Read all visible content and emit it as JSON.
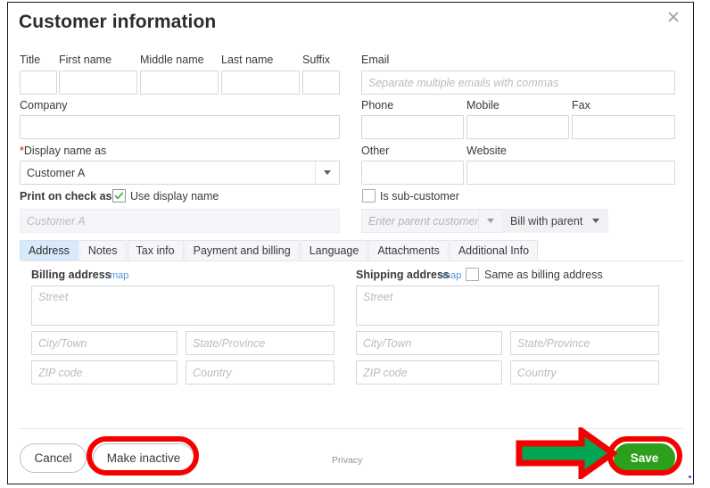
{
  "dialog": {
    "title": "Customer information",
    "close_icon": "close-x-icon"
  },
  "name_row": {
    "fields": [
      {
        "label": "Title",
        "value": "",
        "placeholder": ""
      },
      {
        "label": "First name",
        "value": "",
        "placeholder": ""
      },
      {
        "label": "Middle name",
        "value": "",
        "placeholder": ""
      },
      {
        "label": "Last name",
        "value": "",
        "placeholder": ""
      },
      {
        "label": "Suffix",
        "value": "",
        "placeholder": ""
      }
    ]
  },
  "company": {
    "label": "Company",
    "value": "",
    "placeholder": ""
  },
  "display_name": {
    "required_marker": "*",
    "label": "Display name as",
    "value": "Customer A",
    "dropdown_icon": "chevron-down-icon"
  },
  "print_on_check": {
    "label": "Print on check as",
    "checkbox_label": "Use display name",
    "checked": true,
    "check_icon": "checkmark-icon",
    "value": "",
    "placeholder": "Customer A",
    "disabled": true
  },
  "contact": {
    "email": {
      "label": "Email",
      "value": "",
      "placeholder": "Separate multiple emails with commas"
    },
    "phone": {
      "label": "Phone",
      "value": "",
      "placeholder": ""
    },
    "mobile": {
      "label": "Mobile",
      "value": "",
      "placeholder": ""
    },
    "fax": {
      "label": "Fax",
      "value": "",
      "placeholder": ""
    },
    "other": {
      "label": "Other",
      "value": "",
      "placeholder": ""
    },
    "website": {
      "label": "Website",
      "value": "",
      "placeholder": ""
    }
  },
  "sub_customer": {
    "checkbox_label": "Is sub-customer",
    "checked": false,
    "parent_value": "Enter parent customer",
    "parent_dropdown_icon": "chevron-down-icon",
    "billing_option": "Bill with parent",
    "billing_dropdown_icon": "chevron-down-icon"
  },
  "tabs": {
    "items": [
      {
        "label": "Address",
        "active": true
      },
      {
        "label": "Notes",
        "active": false
      },
      {
        "label": "Tax info",
        "active": false
      },
      {
        "label": "Payment and billing",
        "active": false
      },
      {
        "label": "Language",
        "active": false
      },
      {
        "label": "Attachments",
        "active": false
      },
      {
        "label": "Additional Info",
        "active": false
      }
    ]
  },
  "billing_address": {
    "heading": "Billing address",
    "map_link": "map",
    "street": {
      "value": "",
      "placeholder": "Street"
    },
    "city": {
      "value": "",
      "placeholder": "City/Town"
    },
    "state": {
      "value": "",
      "placeholder": "State/Province"
    },
    "zip": {
      "value": "",
      "placeholder": "ZIP code"
    },
    "country": {
      "value": "",
      "placeholder": "Country"
    }
  },
  "shipping_address": {
    "heading": "Shipping address",
    "map_link": "map",
    "same_as_billing_label": "Same as billing address",
    "same_as_billing_checked": false,
    "street": {
      "value": "",
      "placeholder": "Street"
    },
    "city": {
      "value": "",
      "placeholder": "City/Town"
    },
    "state": {
      "value": "",
      "placeholder": "State/Province"
    },
    "zip": {
      "value": "",
      "placeholder": "ZIP code"
    },
    "country": {
      "value": "",
      "placeholder": "Country"
    }
  },
  "footer": {
    "cancel_label": "Cancel",
    "make_inactive_label": "Make inactive",
    "privacy_label": "Privacy",
    "save_label": "Save"
  },
  "annotations": {
    "highlight_color": "#f50000",
    "arrow_fill": "#00a651",
    "arrow_stroke": "#f50000",
    "make_inactive_highlighted": true,
    "save_highlighted": true,
    "arrow_points_to": "save-button"
  }
}
